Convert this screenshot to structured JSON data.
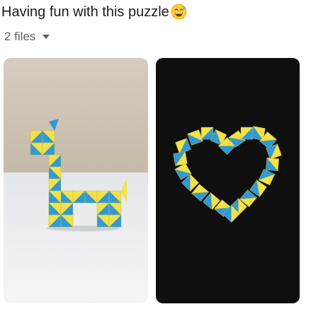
{
  "message": {
    "text": "Having fun with this puzzle",
    "emoji": "grinning-face-with-sweat-emoji"
  },
  "files": {
    "label": "2 files",
    "toggle_icon": "caret-down-icon"
  },
  "attachments": [
    {
      "name": "giraffe-puzzle-photo",
      "subject": "giraffe"
    },
    {
      "name": "heart-puzzle-photo",
      "subject": "heart"
    }
  ],
  "colors": {
    "puzzle_yellow": "#f2e14a",
    "puzzle_blue": "#2e9ad9",
    "wall": "#cfc3b3",
    "table": "#eef0f2",
    "dark_background": "#0f0f10"
  }
}
